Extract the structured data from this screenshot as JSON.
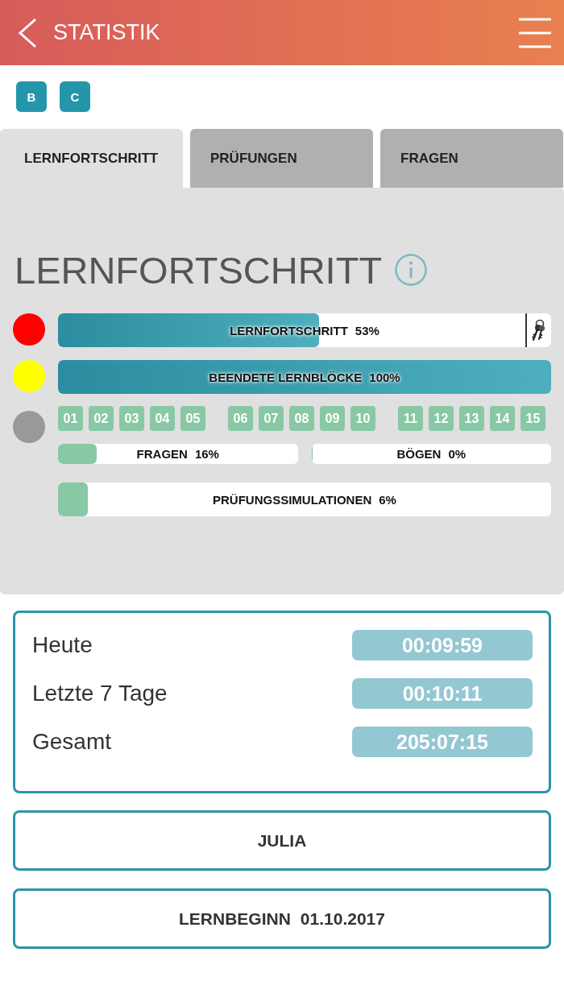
{
  "header": {
    "title": "STATISTIK"
  },
  "classes": [
    {
      "label": "B"
    },
    {
      "label": "C"
    }
  ],
  "tabs": [
    {
      "label": "LERNFORTSCHRITT",
      "selected": true
    },
    {
      "label": "PRÜFUNGEN",
      "selected": false
    },
    {
      "label": "FRAGEN",
      "selected": false
    }
  ],
  "panel": {
    "title": "LERNFORTSCHRITT",
    "stages": [
      {
        "color": "#ff0000",
        "kind": "keyed",
        "bar": {
          "label": "LERNFORTSCHRITT",
          "reading": "53%",
          "level": 0.53
        }
      },
      {
        "color": "#ffff00",
        "kind": "plain",
        "bar": {
          "label": "BEENDETE LERNBLÖCKE",
          "reading": "100%",
          "level": 1
        }
      },
      {
        "color": "#999999",
        "kind": "blocks",
        "block_groups": [
          [
            "01",
            "02",
            "03",
            "04",
            "05"
          ],
          [
            "06",
            "07",
            "08",
            "09",
            "10"
          ],
          [
            "11",
            "12",
            "13",
            "14",
            "15"
          ]
        ],
        "bars": [
          {
            "label": "FRAGEN",
            "reading": "16%",
            "level": 0.16
          },
          {
            "label": "BÖGEN",
            "reading": "0%",
            "level": 0
          }
        ],
        "wide_bar": {
          "label": "PRÜFUNGSSIMULATIONEN",
          "reading": "6%",
          "level": 0.06
        }
      }
    ]
  },
  "times": [
    {
      "label": "Heute",
      "value": "00:09:59"
    },
    {
      "label": "Letzte 7 Tage",
      "value": "00:10:11"
    },
    {
      "label": "Gesamt",
      "value": "205:07:15"
    }
  ],
  "user": {
    "name": "JULIA"
  },
  "start": {
    "label": "LERNBEGINN",
    "date": "01.10.2017"
  }
}
